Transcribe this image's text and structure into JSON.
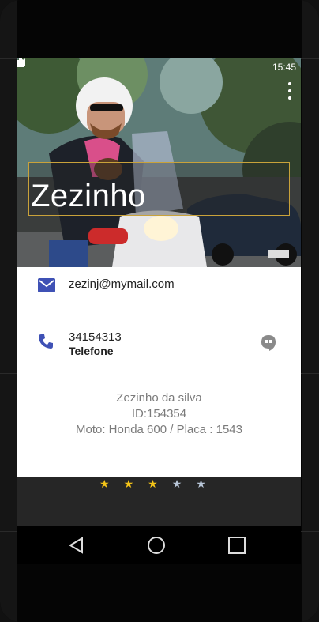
{
  "status_bar": {
    "time": "15:45"
  },
  "contact": {
    "name": "Zezinho",
    "email": "zezinj@mymail.com",
    "phone_number": "34154313",
    "phone_type": "Telefone",
    "full_name": "Zezinho da silva",
    "id_line": "ID:154354",
    "moto_line": "Moto: Honda 600 / Placa : 1543"
  },
  "rating": {
    "value": 3,
    "max": 5,
    "stars": [
      "★",
      "★",
      "★",
      "★",
      "★"
    ],
    "filled_color": "#f5c518",
    "empty_color": "#b8c6d8"
  },
  "colors": {
    "accent_blue": "#3f51b5",
    "name_box_border": "#c9a23a"
  },
  "icons": {
    "email": "email-icon",
    "phone": "phone-icon",
    "hangouts": "hangouts-icon",
    "back": "back-icon",
    "home": "home-icon",
    "recents": "recents-icon"
  }
}
